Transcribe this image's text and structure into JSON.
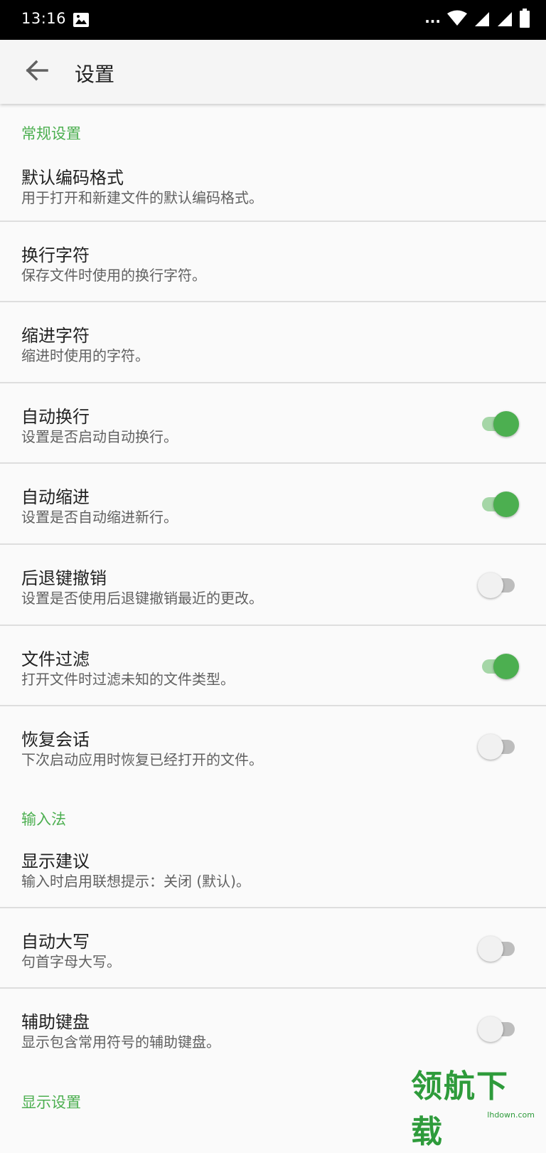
{
  "status_bar": {
    "time": "13:16",
    "dots": "...",
    "icons": [
      "image-icon",
      "wifi-icon",
      "signal-icon",
      "signal-icon",
      "battery-icon"
    ]
  },
  "app_bar": {
    "back_icon": "arrow-left-icon",
    "title": "设置"
  },
  "sections": {
    "general": "常规设置",
    "input": "输入法",
    "display": "显示设置"
  },
  "prefs": [
    {
      "title": "默认编码格式",
      "summary": "用于打开和新建文件的默认编码格式。"
    },
    {
      "title": "换行字符",
      "summary": "保存文件时使用的换行字符。"
    },
    {
      "title": "缩进字符",
      "summary": "缩进时使用的字符。"
    },
    {
      "title": "自动换行",
      "summary": "设置是否启动自动换行。",
      "enabled": true
    },
    {
      "title": "自动缩进",
      "summary": "设置是否自动缩进新行。",
      "enabled": true
    },
    {
      "title": "后退键撤销",
      "summary": "设置是否使用后退键撤销最近的更改。",
      "enabled": false
    },
    {
      "title": "文件过滤",
      "summary": "打开文件时过滤未知的文件类型。",
      "enabled": true
    },
    {
      "title": "恢复会话",
      "summary": "下次启动应用时恢复已经打开的文件。",
      "enabled": false
    },
    {
      "title": "显示建议",
      "summary": "输入时启用联想提示：关闭 (默认)。"
    },
    {
      "title": "自动大写",
      "summary": "句首字母大写。",
      "enabled": false
    },
    {
      "title": "辅助键盘",
      "summary": "显示包含常用符号的辅助键盘。",
      "enabled": false
    }
  ],
  "watermark": {
    "text": "领航下载",
    "url": "lhdown.com"
  },
  "colors": {
    "accent": "#4caf50",
    "status_bar": "#000000",
    "app_bar": "#f5f5f5",
    "background": "#fafafa"
  }
}
